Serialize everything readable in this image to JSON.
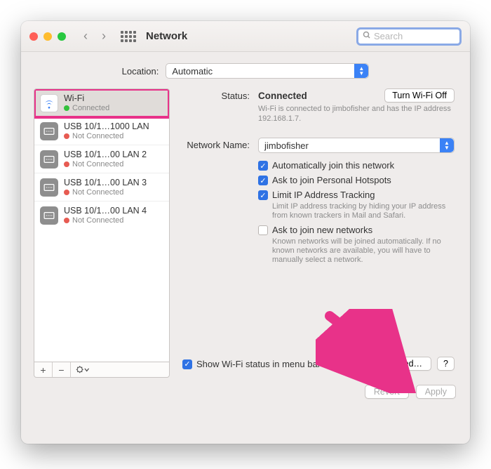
{
  "window": {
    "title": "Network",
    "search_placeholder": "Search"
  },
  "location": {
    "label": "Location:",
    "value": "Automatic"
  },
  "sidebar": {
    "items": [
      {
        "name": "Wi-Fi",
        "status": "Connected",
        "connected": true,
        "kind": "wifi"
      },
      {
        "name": "USB 10/1…1000 LAN",
        "status": "Not Connected",
        "connected": false,
        "kind": "eth"
      },
      {
        "name": "USB 10/1…00 LAN 2",
        "status": "Not Connected",
        "connected": false,
        "kind": "eth"
      },
      {
        "name": "USB 10/1…00 LAN 3",
        "status": "Not Connected",
        "connected": false,
        "kind": "eth"
      },
      {
        "name": "USB 10/1…00 LAN 4",
        "status": "Not Connected",
        "connected": false,
        "kind": "eth"
      }
    ],
    "toolbar": {
      "add": "+",
      "remove": "−",
      "actions": "☺︎﹀"
    }
  },
  "panel": {
    "status_label": "Status:",
    "status_value": "Connected",
    "turn_off": "Turn Wi-Fi Off",
    "status_desc": "Wi-Fi is connected to jimbofisher and has the IP address 192.168.1.7.",
    "network_label": "Network Name:",
    "network_value": "jimbofisher",
    "checks": [
      {
        "label": "Automatically join this network",
        "checked": true,
        "desc": ""
      },
      {
        "label": "Ask to join Personal Hotspots",
        "checked": true,
        "desc": ""
      },
      {
        "label": "Limit IP Address Tracking",
        "checked": true,
        "desc": "Limit IP address tracking by hiding your IP address from known trackers in Mail and Safari."
      },
      {
        "label": "Ask to join new networks",
        "checked": false,
        "desc": "Known networks will be joined automatically. If no known networks are available, you will have to manually select a network."
      }
    ],
    "show_menubar": {
      "label": "Show Wi-Fi status in menu bar",
      "checked": true
    },
    "advanced": "Advanced…",
    "help": "?"
  },
  "footer": {
    "revert": "Revert",
    "apply": "Apply"
  }
}
